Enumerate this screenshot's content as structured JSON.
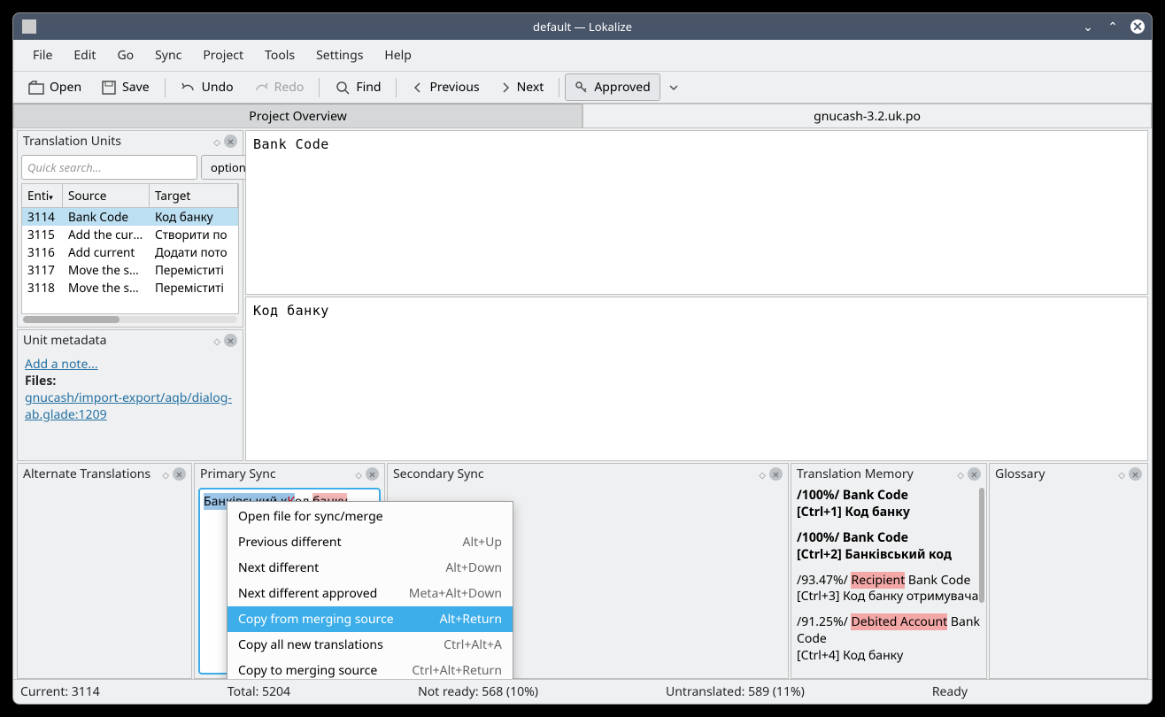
{
  "titlebar": {
    "title": "default — Lokalize"
  },
  "menubar": [
    "File",
    "Edit",
    "Go",
    "Sync",
    "Project",
    "Tools",
    "Settings",
    "Help"
  ],
  "toolbar": {
    "open": "Open",
    "save": "Save",
    "undo": "Undo",
    "redo": "Redo",
    "find": "Find",
    "previous": "Previous",
    "next": "Next",
    "approved": "Approved"
  },
  "tabs": {
    "overview": "Project Overview",
    "file": "gnucash-3.2.uk.po"
  },
  "tu": {
    "title": "Translation Units",
    "placeholder": "Quick search...",
    "options": "options",
    "cols": {
      "entry": "Enti",
      "source": "Source",
      "target": "Target"
    },
    "rows": [
      {
        "n": "3114",
        "s": "Bank Code",
        "t": "Код банку"
      },
      {
        "n": "3115",
        "s": "Add the curr…",
        "t": "Створити по"
      },
      {
        "n": "3116",
        "s": "Add current",
        "t": "Додати пото"
      },
      {
        "n": "3117",
        "s": "Move the sel…",
        "t": "Переміститі"
      },
      {
        "n": "3118",
        "s": "Move the sel…",
        "t": "Переміститі"
      }
    ]
  },
  "meta": {
    "title": "Unit metadata",
    "addnote": "Add a note...",
    "fileslabel": "Files:",
    "filelink": "gnucash/import-export/aqb/dialog-ab.glade:1209"
  },
  "editor": {
    "source": "Bank Code",
    "target": "Код банку"
  },
  "panels": {
    "alt": "Alternate Translations",
    "psync": "Primary Sync",
    "ssync": "Secondary Sync",
    "tm": "Translation Memory",
    "gloss": "Glossary"
  },
  "psync": {
    "del": "Банківський к",
    "delred": "К",
    "mid": "од ",
    "add": "банку"
  },
  "ctx": [
    {
      "l": "Open file for sync/merge",
      "s": ""
    },
    {
      "l": "Previous different",
      "s": "Alt+Up"
    },
    {
      "l": "Next different",
      "s": "Alt+Down"
    },
    {
      "l": "Next different approved",
      "s": "Meta+Alt+Down"
    },
    {
      "l": "Copy from merging source",
      "s": "Alt+Return"
    },
    {
      "l": "Copy all new translations",
      "s": "Ctrl+Alt+A"
    },
    {
      "l": "Copy to merging source",
      "s": "Ctrl+Alt+Return"
    }
  ],
  "tm": [
    {
      "pct": "/100%/ ",
      "txt": "Bank Code",
      "key": "[Ctrl+1] ",
      "tr": "Код банку",
      "bold": true
    },
    {
      "pct": "/100%/ ",
      "txt": "Bank Code",
      "key": "[Ctrl+2] ",
      "tr": "Банківський код",
      "bold": true
    },
    {
      "pct": "/93.47%/ ",
      "hl": "Recipient ",
      "txt": "Bank Code",
      "key": "[Ctrl+3] ",
      "tr": "Код банку отримувача"
    },
    {
      "pct": "/91.25%/ ",
      "hl": "Debited Account ",
      "txt": "Bank Code",
      "key": "[Ctrl+4] ",
      "tr": "Код банку"
    }
  ],
  "status": {
    "current": "Current: 3114",
    "total": "Total: 5204",
    "notready": "Not ready: 568 (10%)",
    "untranslated": "Untranslated: 589 (11%)",
    "ready": "Ready"
  }
}
